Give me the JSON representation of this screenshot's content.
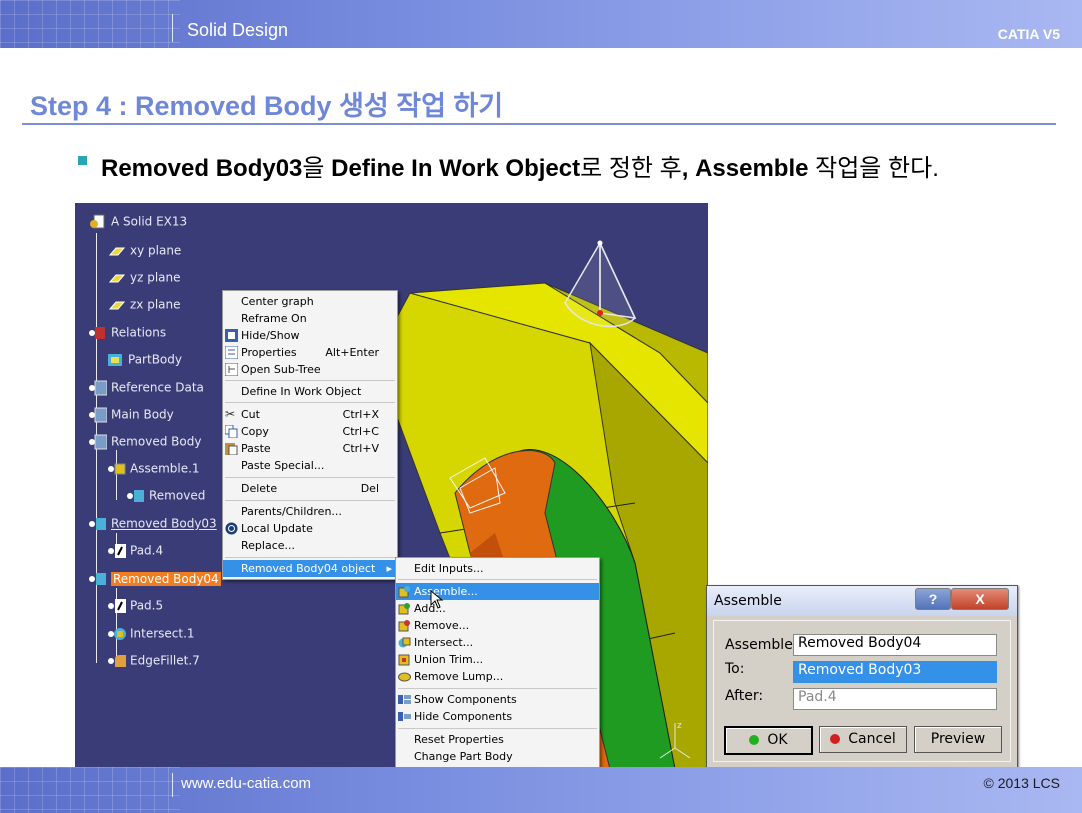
{
  "header": {
    "title": "Solid Design",
    "product": "CATIA V5"
  },
  "footer": {
    "url": "www.edu-catia.com",
    "copyright": "© 2013 LCS"
  },
  "step": {
    "title": "Step 4 : Removed Body 생성 작업 하기"
  },
  "instruction": {
    "part1": "Removed Body03",
    "part2": "을 ",
    "part3": "Define In Work Object",
    "part4": "로 정한 후",
    "part5": ", Assemble",
    "part6": " 작업을 한다."
  },
  "tree": [
    {
      "label": "A Solid EX13",
      "icon": "part-icon"
    },
    {
      "label": "xy plane",
      "icon": "plane-icon"
    },
    {
      "label": "yz plane",
      "icon": "plane-icon"
    },
    {
      "label": "zx plane",
      "icon": "plane-icon"
    },
    {
      "label": "Relations",
      "icon": "relations-icon"
    },
    {
      "label": "PartBody",
      "icon": "body-icon"
    },
    {
      "label": "Reference Data",
      "icon": "geoset-icon"
    },
    {
      "label": "Main Body",
      "icon": "geoset-icon"
    },
    {
      "label": "Removed Body",
      "icon": "geoset-icon"
    },
    {
      "label": "Assemble.1",
      "icon": "assemble-icon"
    },
    {
      "label": "Removed",
      "icon": "body-icon"
    },
    {
      "label": "Removed Body03",
      "icon": "body-icon"
    },
    {
      "label": "Pad.4",
      "icon": "pad-icon"
    },
    {
      "label": "Removed Body04",
      "icon": "body-icon"
    },
    {
      "label": "Pad.5",
      "icon": "pad-icon"
    },
    {
      "label": "Intersect.1",
      "icon": "intersect-icon"
    },
    {
      "label": "EdgeFillet.7",
      "icon": "fillet-icon"
    }
  ],
  "context_menu": {
    "items": [
      {
        "label": "Center graph",
        "shortcut": ""
      },
      {
        "label": "Reframe On",
        "shortcut": ""
      },
      {
        "label": "Hide/Show",
        "shortcut": ""
      },
      {
        "label": "Properties",
        "shortcut": "Alt+Enter"
      },
      {
        "label": "Open Sub-Tree",
        "shortcut": ""
      },
      {
        "label": "Define In Work Object",
        "shortcut": ""
      },
      {
        "label": "Cut",
        "shortcut": "Ctrl+X"
      },
      {
        "label": "Copy",
        "shortcut": "Ctrl+C"
      },
      {
        "label": "Paste",
        "shortcut": "Ctrl+V"
      },
      {
        "label": "Paste Special...",
        "shortcut": ""
      },
      {
        "label": "Delete",
        "shortcut": "Del"
      },
      {
        "label": "Parents/Children...",
        "shortcut": ""
      },
      {
        "label": "Local Update",
        "shortcut": ""
      },
      {
        "label": "Replace...",
        "shortcut": ""
      },
      {
        "label": "Removed Body04 object",
        "shortcut": ""
      }
    ]
  },
  "submenu": {
    "items": [
      {
        "label": "Edit Inputs..."
      },
      {
        "label": "Assemble..."
      },
      {
        "label": "Add..."
      },
      {
        "label": "Remove..."
      },
      {
        "label": "Intersect..."
      },
      {
        "label": "Union Trim..."
      },
      {
        "label": "Remove Lump..."
      },
      {
        "label": "Show Components"
      },
      {
        "label": "Hide Components"
      },
      {
        "label": "Reset Properties"
      },
      {
        "label": "Change Part Body"
      }
    ]
  },
  "dialog": {
    "title": "Assemble",
    "help": "?",
    "close": "X",
    "assemble_label": "Assemble",
    "assemble_value": "Removed Body04",
    "to_label": "To:",
    "to_value": "Removed Body03",
    "after_label": "After:",
    "after_value": "Pad.4",
    "ok": "OK",
    "cancel": "Cancel",
    "preview": "Preview"
  },
  "compass": {
    "z_label": "z"
  },
  "colors": {
    "accent": "#6f87d9",
    "viewport_bg": "#3a3c77",
    "highlight": "#3591e8",
    "selection": "#f07d20"
  }
}
